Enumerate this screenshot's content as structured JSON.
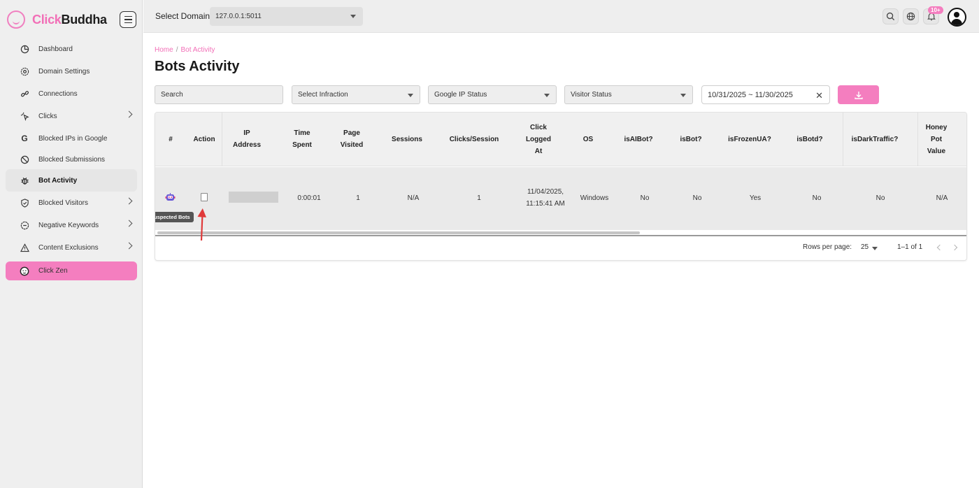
{
  "brand": {
    "name_part1": "Click",
    "name_part2": "Buddha",
    "accent": "#f47ebf"
  },
  "sidebar": {
    "items": [
      {
        "label": "Dashboard",
        "icon": "pie-chart-icon",
        "has_submenu": false
      },
      {
        "label": "Domain Settings",
        "icon": "gear-icon",
        "has_submenu": false
      },
      {
        "label": "Connections",
        "icon": "link-icon",
        "has_submenu": false
      },
      {
        "label": "Clicks",
        "icon": "cursor-click-icon",
        "has_submenu": true
      },
      {
        "label": "Blocked IPs in Google",
        "icon": "google-g-icon",
        "has_submenu": false
      },
      {
        "label": "Blocked Submissions",
        "icon": "block-icon",
        "has_submenu": false
      },
      {
        "label": "Bot Activity",
        "icon": "bug-icon",
        "has_submenu": false,
        "active": true
      },
      {
        "label": "Blocked Visitors",
        "icon": "shield-icon",
        "has_submenu": true
      },
      {
        "label": "Negative Keywords",
        "icon": "badge-minus-icon",
        "has_submenu": true
      },
      {
        "label": "Content Exclusions",
        "icon": "warning-triangle-icon",
        "has_submenu": true
      },
      {
        "label": "Click Zen",
        "icon": "buddha-face-icon",
        "has_submenu": false,
        "highlight": true
      }
    ]
  },
  "header": {
    "select_domain_label": "Select Domain",
    "domain_value": "127.0.0.1:5011",
    "notifications_badge": "10+"
  },
  "breadcrumb": {
    "home": "Home",
    "separator": "/",
    "current": "Bot Activity"
  },
  "page_title": "Bots Activity",
  "filters": {
    "search_placeholder": "Search",
    "infraction": "Select Infraction",
    "google_ip_status": "Google IP Status",
    "visitor_status": "Visitor Status",
    "date_range": "10/31/2025 ~ 11/30/2025"
  },
  "table": {
    "columns": {
      "num": "#",
      "action": "Action",
      "ip": [
        "IP",
        "Address"
      ],
      "time": [
        "Time",
        "Spent"
      ],
      "page": [
        "Page",
        "Visited"
      ],
      "sessions": "Sessions",
      "cps": "Clicks/Session",
      "logged": [
        "Click",
        "Logged",
        "At"
      ],
      "os": "OS",
      "isaibot": "isAIBot?",
      "isbot": "isBot?",
      "isfrozen": "isFrozenUA?",
      "isbotd": "isBotd?",
      "isdark": "isDarkTraffic?",
      "honey": [
        "Honey",
        "Pot",
        "Value"
      ]
    },
    "rows": [
      {
        "tooltip": "Suspected Bots",
        "time_spent": "0:00:01",
        "page_visited": "1",
        "sessions": "N/A",
        "clicks_per_session": "1",
        "logged_at": [
          "11/04/2025,",
          "11:15:41 AM"
        ],
        "os": "Windows",
        "is_ai_bot": "No",
        "is_bot": "No",
        "is_frozen_ua": "Yes",
        "is_botd": "No",
        "is_dark_traffic": "No",
        "honey_pot_value": "N/A"
      }
    ]
  },
  "pagination": {
    "rows_per_page_label": "Rows per page:",
    "rows_per_page_value": "25",
    "range": "1–1 of 1"
  }
}
